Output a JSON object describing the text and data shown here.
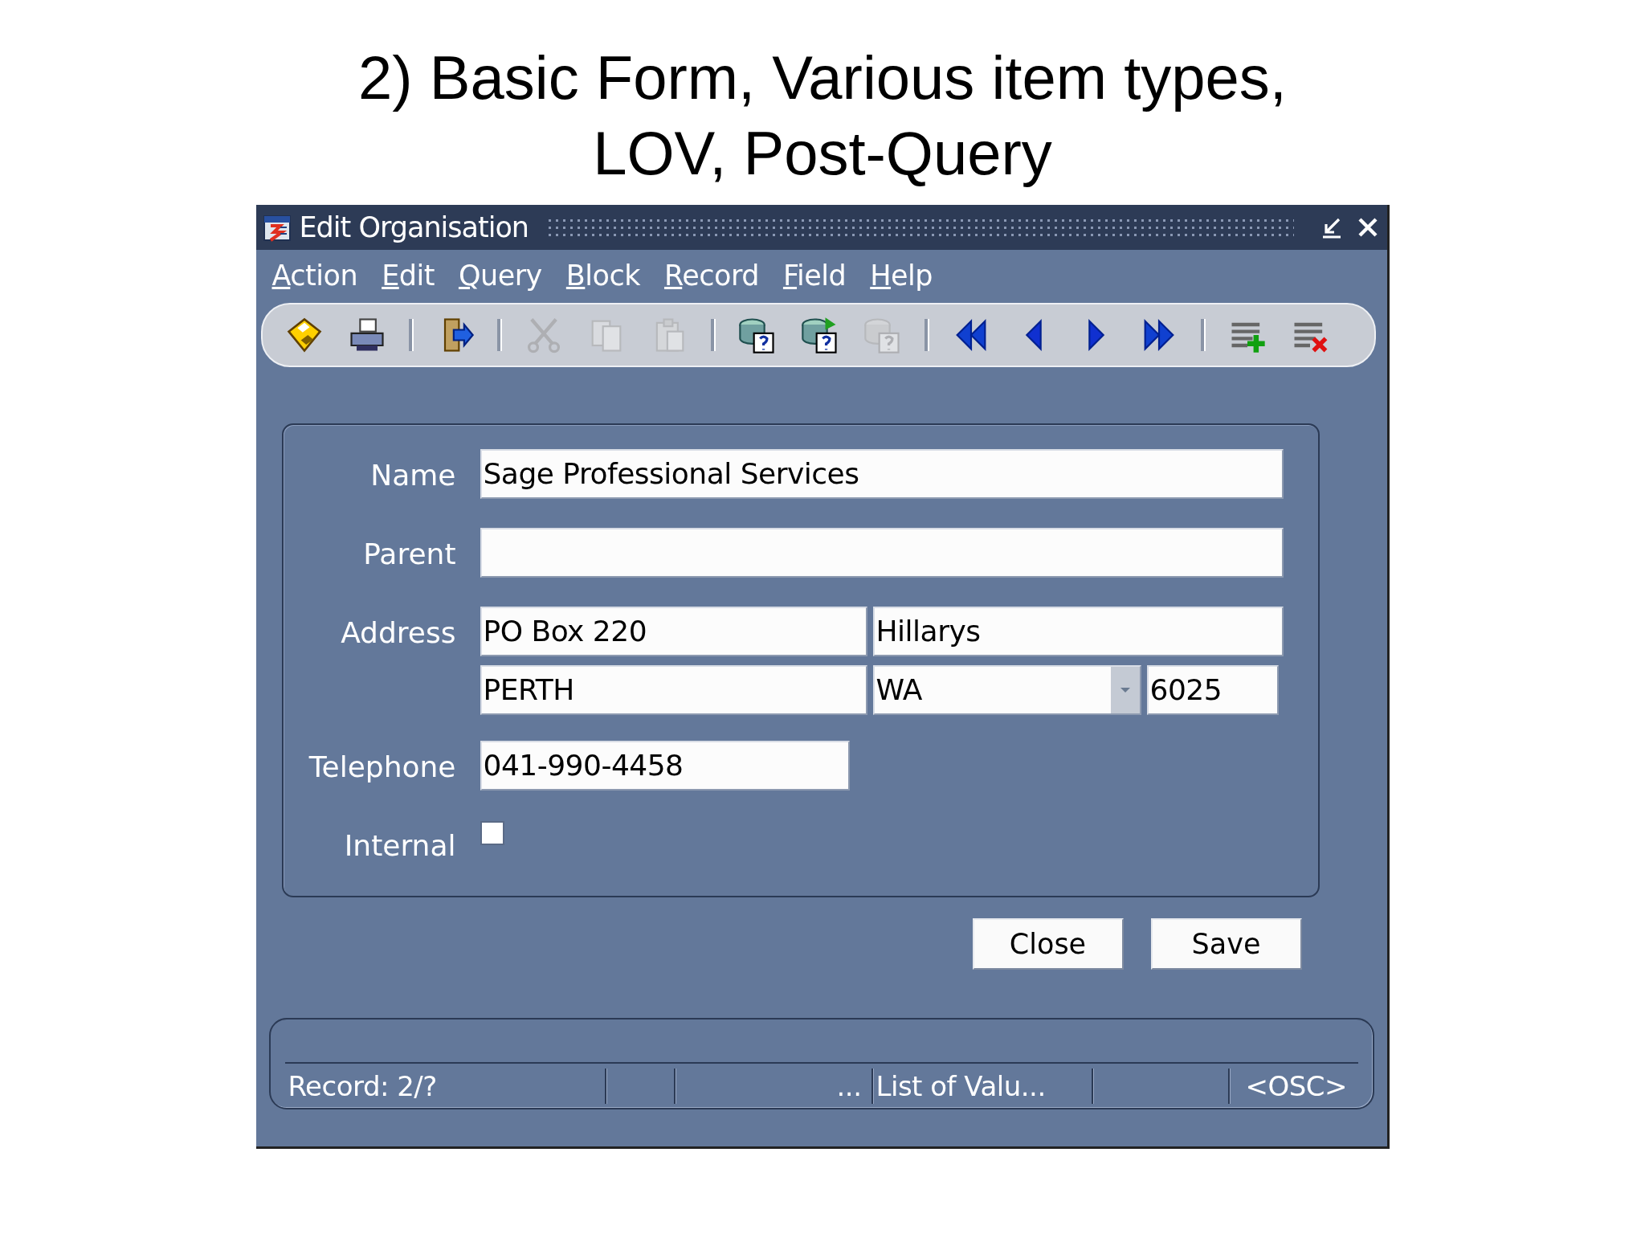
{
  "slide_title": [
    "2) Basic Form, Various item types,",
    "LOV, Post-Query"
  ],
  "window": {
    "title": "Edit Organisation"
  },
  "menu": [
    "Action",
    "Edit",
    "Query",
    "Block",
    "Record",
    "Field",
    "Help"
  ],
  "toolbar": [
    {
      "kind": "save",
      "disabled": false
    },
    {
      "kind": "print",
      "disabled": false
    },
    {
      "kind": "separator"
    },
    {
      "kind": "exit",
      "disabled": false
    },
    {
      "kind": "separator"
    },
    {
      "kind": "cut",
      "disabled": true
    },
    {
      "kind": "copy",
      "disabled": true
    },
    {
      "kind": "paste",
      "disabled": true
    },
    {
      "kind": "separator"
    },
    {
      "kind": "enter-query",
      "disabled": false
    },
    {
      "kind": "execute-query",
      "disabled": false
    },
    {
      "kind": "count-query",
      "disabled": true
    },
    {
      "kind": "separator"
    },
    {
      "kind": "first",
      "disabled": false
    },
    {
      "kind": "previous",
      "disabled": false
    },
    {
      "kind": "next",
      "disabled": false
    },
    {
      "kind": "last",
      "disabled": false
    },
    {
      "kind": "separator"
    },
    {
      "kind": "insert-record",
      "disabled": false
    },
    {
      "kind": "delete-record",
      "disabled": false
    }
  ],
  "form": {
    "rows": [
      {
        "label": "Name",
        "fields": [
          {
            "kind": "text",
            "value": "Sage Professional Services"
          }
        ]
      },
      {
        "label": "Parent",
        "fields": [
          {
            "kind": "text"
          }
        ]
      },
      {
        "label": "Address",
        "fields": [
          {
            "kind": "text",
            "value": "PO Box 220"
          },
          {
            "kind": "text",
            "value": "Hillarys"
          }
        ]
      },
      {
        "fields": [
          {
            "kind": "text",
            "value": "PERTH"
          },
          {
            "kind": "dropdown",
            "value": "WA"
          },
          {
            "kind": "text",
            "value": "6025"
          }
        ]
      },
      {
        "label": "Telephone",
        "fields": [
          {
            "kind": "text",
            "value": "041-990-4458"
          }
        ]
      },
      {
        "label": "Internal",
        "fields": [
          {
            "kind": "checkbox",
            "checked": false
          }
        ]
      }
    ]
  },
  "buttons": [
    "Close",
    "Save"
  ],
  "status_bar": {
    "segments": [
      "Record: 2/?",
      "...",
      "List of Valu...",
      "<OSC>"
    ]
  }
}
